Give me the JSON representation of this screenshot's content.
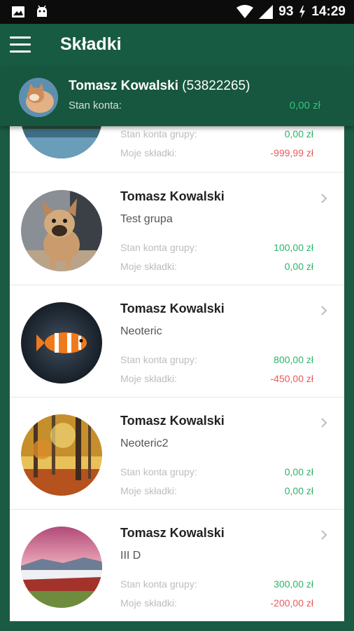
{
  "status": {
    "battery": "93",
    "time": "14:29"
  },
  "appbar": {
    "title": "Składki"
  },
  "account": {
    "name": "Tomasz Kowalski",
    "id": "(53822265)",
    "balance_label": "Stan konta:",
    "balance_value": "0,00 zł"
  },
  "cards": [
    {
      "name": "",
      "group": "",
      "group_balance_label": "Stan konta grupy:",
      "group_balance": "0,00 zł",
      "my_label": "Moje składki:",
      "my_fees": "-999,99 zł"
    },
    {
      "name": "Tomasz Kowalski",
      "group": "Test grupa",
      "group_balance_label": "Stan konta grupy:",
      "group_balance": "100,00 zł",
      "my_label": "Moje składki:",
      "my_fees": "0,00 zł"
    },
    {
      "name": "Tomasz Kowalski",
      "group": "Neoteric",
      "group_balance_label": "Stan konta grupy:",
      "group_balance": "800,00 zł",
      "my_label": "Moje składki:",
      "my_fees": "-450,00 zł"
    },
    {
      "name": "Tomasz Kowalski",
      "group": "Neoteric2",
      "group_balance_label": "Stan konta grupy:",
      "group_balance": "0,00 zł",
      "my_label": "Moje składki:",
      "my_fees": "0,00 zł"
    },
    {
      "name": "Tomasz Kowalski",
      "group": "III D",
      "group_balance_label": "Stan konta grupy:",
      "group_balance": "300,00 zł",
      "my_label": "Moje składki:",
      "my_fees": "-200,00 zł"
    }
  ],
  "colors": {
    "primary": "#175b42",
    "positive": "#2fb36b",
    "negative": "#ea5a5a"
  }
}
